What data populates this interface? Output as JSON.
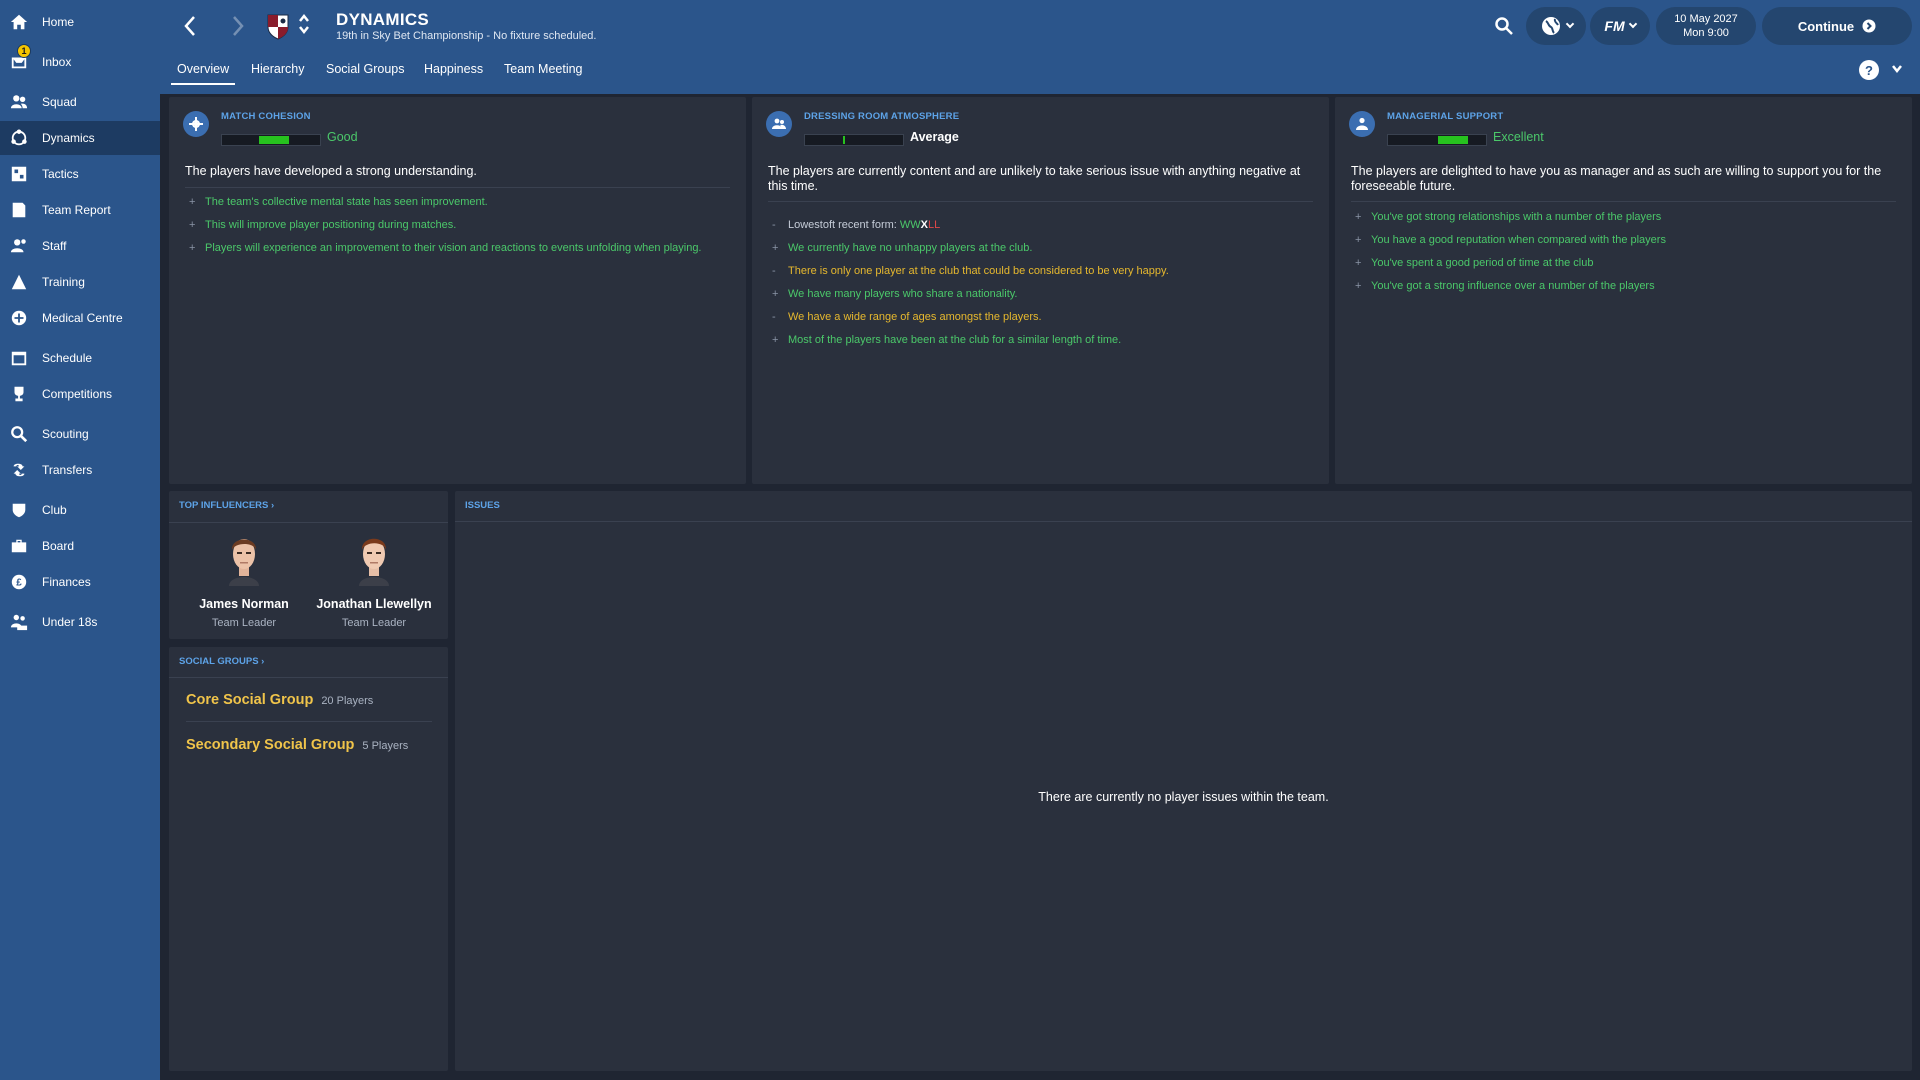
{
  "sidebar": {
    "items": [
      {
        "label": "Home",
        "icon": "home-icon"
      },
      {
        "label": "Inbox",
        "icon": "inbox-icon",
        "badge": "1"
      },
      {
        "label": "Squad",
        "icon": "squad-icon"
      },
      {
        "label": "Dynamics",
        "icon": "dynamics-icon"
      },
      {
        "label": "Tactics",
        "icon": "tactics-icon"
      },
      {
        "label": "Team Report",
        "icon": "team-report-icon"
      },
      {
        "label": "Staff",
        "icon": "staff-icon"
      },
      {
        "label": "Training",
        "icon": "training-icon"
      },
      {
        "label": "Medical Centre",
        "icon": "medical-icon"
      },
      {
        "label": "Schedule",
        "icon": "schedule-icon"
      },
      {
        "label": "Competitions",
        "icon": "trophy-icon"
      },
      {
        "label": "Scouting",
        "icon": "search-icon"
      },
      {
        "label": "Transfers",
        "icon": "transfers-icon"
      },
      {
        "label": "Club",
        "icon": "club-icon"
      },
      {
        "label": "Board",
        "icon": "board-icon"
      },
      {
        "label": "Finances",
        "icon": "finances-icon"
      },
      {
        "label": "Under 18s",
        "icon": "under18-icon"
      }
    ],
    "active": "Dynamics"
  },
  "header": {
    "title": "DYNAMICS",
    "subtitle": "19th in Sky Bet Championship - No fixture scheduled.",
    "date": "10 May 2027",
    "time": "Mon 9:00",
    "continue_label": "Continue",
    "fm_label": "FM",
    "help_label": "?",
    "tabs": [
      "Overview",
      "Hierarchy",
      "Social Groups",
      "Happiness",
      "Team Meeting"
    ],
    "active_tab": "Overview"
  },
  "colors": {
    "header_blue": "#2b558b",
    "background": "#1f2532",
    "panel": "#2a303d",
    "positive": "#4bc86a",
    "warning": "#e6b82e",
    "section_title": "#5da3e8"
  },
  "match_cohesion": {
    "title": "MATCH COHESION",
    "rating": "Good",
    "level": 0.6,
    "description": "The players have developed a strong understanding.",
    "facts": [
      {
        "sym": "+",
        "text": "The team's collective mental state has seen improvement."
      },
      {
        "sym": "+",
        "text": "This will improve player positioning during matches."
      },
      {
        "sym": "+",
        "text": "Players will experience an improvement to their vision and reactions to events unfolding when playing."
      }
    ]
  },
  "dressing_room": {
    "title": "DRESSING ROOM ATMOSPHERE",
    "rating": "Average",
    "level": 0.5,
    "description": "The players are currently content and are unlikely to take serious issue with anything negative at this time.",
    "form_label": "Lowestoft recent form:",
    "form": [
      "W",
      "W",
      "X",
      "L",
      "L"
    ],
    "facts": [
      {
        "sym": "+",
        "text": "We currently have no unhappy players at the club.",
        "tone": "green"
      },
      {
        "sym": "-",
        "text": "There is only one player at the club that could be considered to be very happy.",
        "tone": "yellow"
      },
      {
        "sym": "+",
        "text": "We have many players who share a nationality.",
        "tone": "green"
      },
      {
        "sym": "-",
        "text": "We have a wide range of ages amongst the players.",
        "tone": "yellow"
      },
      {
        "sym": "+",
        "text": "Most of the players have been at the club for a similar length of time.",
        "tone": "green"
      }
    ]
  },
  "managerial_support": {
    "title": "MANAGERIAL SUPPORT",
    "rating": "Excellent",
    "level": 0.8,
    "description": "The players are delighted to have you as manager and as such are willing to support you for the foreseeable future.",
    "facts": [
      {
        "sym": "+",
        "text": "You've got strong relationships with a number of the players"
      },
      {
        "sym": "+",
        "text": "You have a good reputation when compared with the players"
      },
      {
        "sym": "+",
        "text": "You've spent a good period of time at the club"
      },
      {
        "sym": "+",
        "text": "You've got a strong influence over a number of the players"
      }
    ]
  },
  "influencers": {
    "title": "TOP INFLUENCERS",
    "players": [
      {
        "name": "James Norman",
        "role": "Team Leader"
      },
      {
        "name": "Jonathan Llewellyn",
        "role": "Team Leader"
      }
    ]
  },
  "social_groups": {
    "title": "SOCIAL GROUPS",
    "groups": [
      {
        "name": "Core Social Group",
        "count": "20 Players"
      },
      {
        "name": "Secondary Social Group",
        "count": "5 Players"
      }
    ]
  },
  "issues": {
    "title": "ISSUES",
    "empty_message": "There are currently no player issues within the team."
  }
}
